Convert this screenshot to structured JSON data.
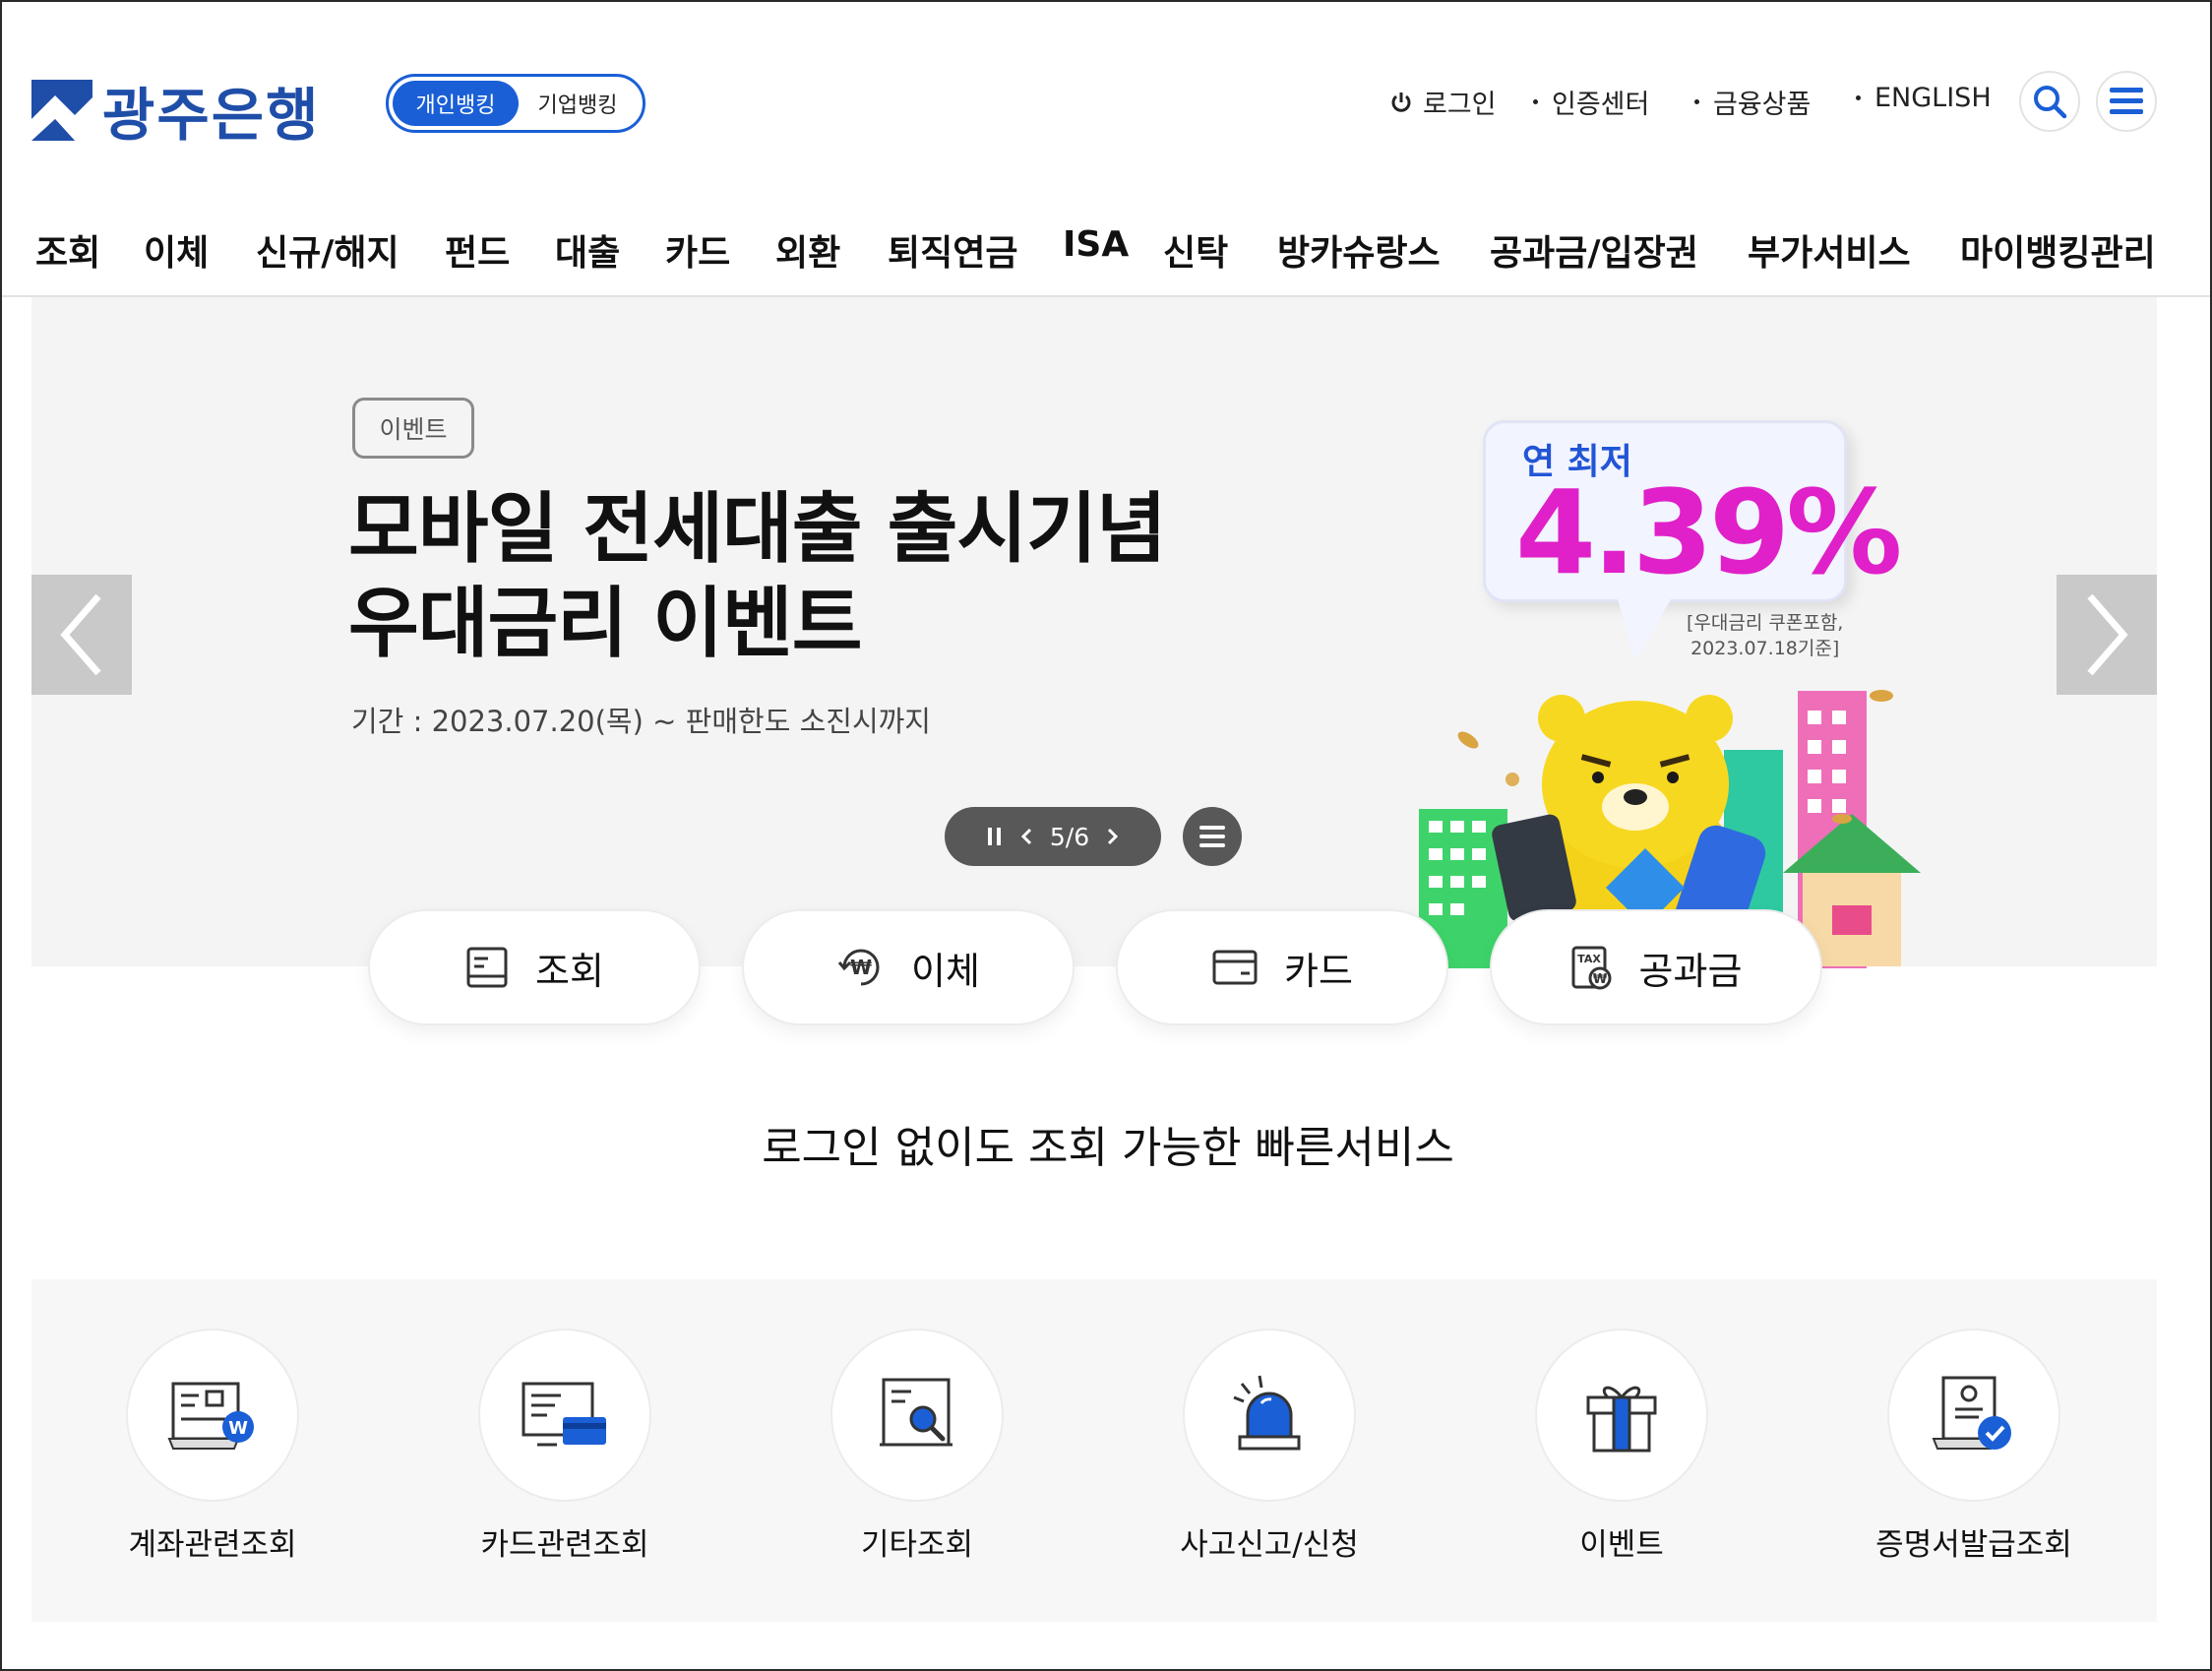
{
  "brand": {
    "name": "광주은행"
  },
  "banking_toggle": {
    "personal": "개인뱅킹",
    "corporate": "기업뱅킹"
  },
  "util_links": {
    "login": "로그인",
    "cert": "인증센터",
    "products": "금융상품",
    "english": "ENGLISH"
  },
  "icons": {
    "search": "search-icon",
    "menu": "menu-icon",
    "power": "power-icon"
  },
  "gnb": [
    "조회",
    "이체",
    "신규/해지",
    "펀드",
    "대출",
    "카드",
    "외환",
    "퇴직연금",
    "ISA",
    "신탁",
    "방카슈랑스",
    "공과금/입장권",
    "부가서비스",
    "마이뱅킹관리"
  ],
  "hero": {
    "tag": "이벤트",
    "title_line1": "모바일 전세대출 출시기념",
    "title_line2": "우대금리 이벤트",
    "period": "기간 : 2023.07.20(목) ~ 판매한도 소진시까지",
    "rate_label": "연 최저",
    "rate_value": "4.39%",
    "rate_note1": "[우대금리 쿠폰포함,",
    "rate_note2": "2023.07.18기준]",
    "pager": "5/6"
  },
  "quick_buttons": [
    "조회",
    "이체",
    "카드",
    "공과금"
  ],
  "section_title": "로그인 없이도 조회 가능한 빠른서비스",
  "services": [
    "계좌관련조회",
    "카드관련조회",
    "기타조회",
    "사고신고/신청",
    "이벤트",
    "증명서발급조회"
  ],
  "colors": {
    "brand_blue": "#1a5fd6",
    "logo_blue": "#1f4ea8",
    "rate_pink": "#e020c8"
  }
}
